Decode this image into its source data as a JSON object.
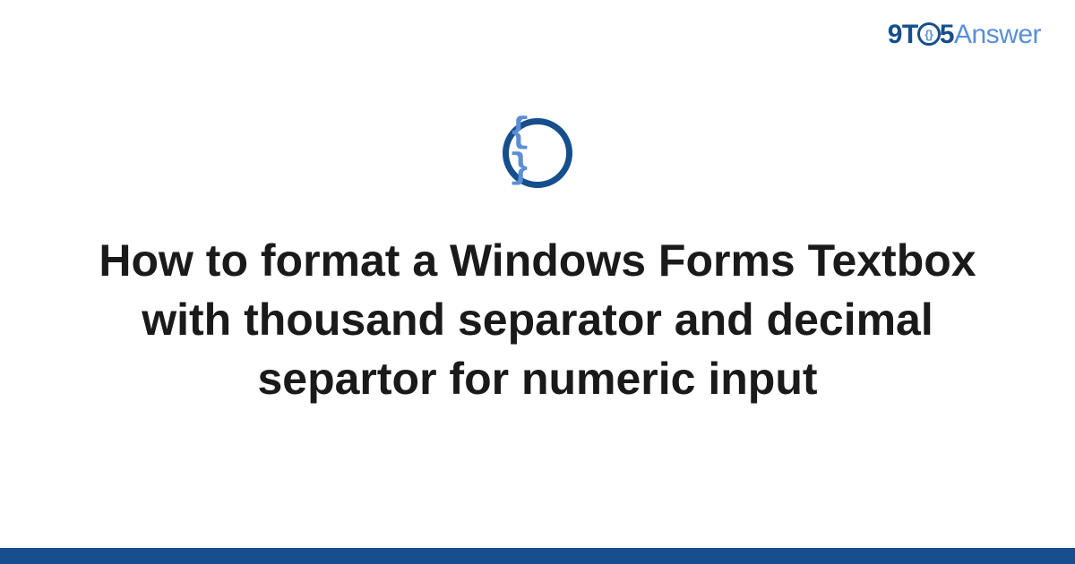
{
  "logo": {
    "part1": "9T",
    "circle_inner": "{}",
    "part2": "5",
    "part3": "Answer"
  },
  "icon": {
    "symbol": "{ }"
  },
  "title": "How to format a Windows Forms Textbox with thousand separator and decimal separtor for numeric input",
  "colors": {
    "primary": "#174e8c",
    "secondary": "#5a8fd4",
    "text": "#1a1a1a",
    "background": "#ffffff"
  }
}
